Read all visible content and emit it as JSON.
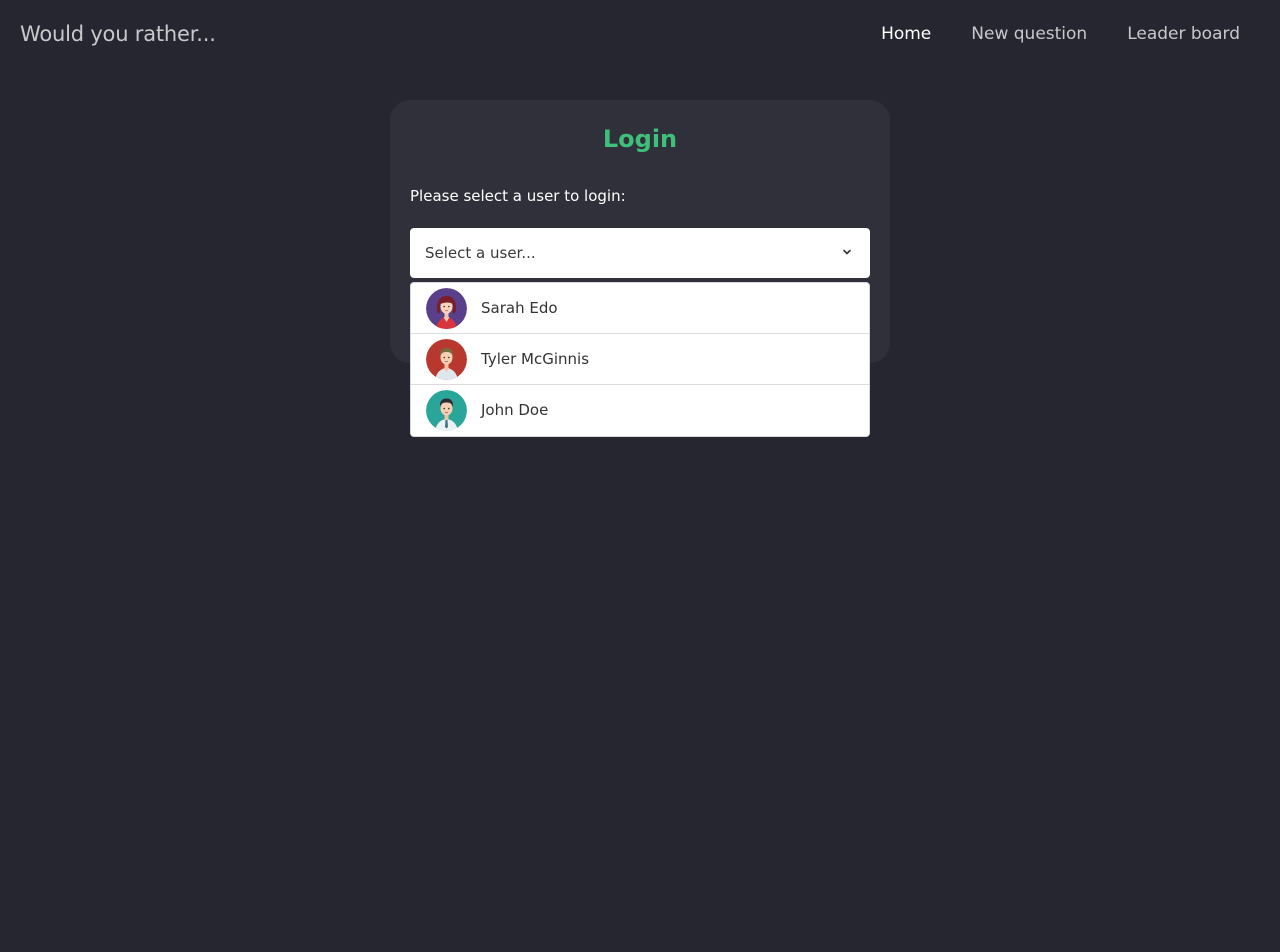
{
  "nav": {
    "brand": "Would you rather...",
    "links": [
      {
        "label": "Home",
        "active": true
      },
      {
        "label": "New question",
        "active": false
      },
      {
        "label": "Leader board",
        "active": false
      }
    ]
  },
  "login": {
    "title": "Login",
    "prompt": "Please select a user to login:",
    "select_placeholder": "Select a user...",
    "options": [
      {
        "name": "Sarah Edo",
        "avatar_bg": "#5a3f8a",
        "avatar_icon": "woman-avatar-icon"
      },
      {
        "name": "Tyler McGinnis",
        "avatar_bg": "#b8382f",
        "avatar_icon": "man-avatar-icon"
      },
      {
        "name": "John Doe",
        "avatar_bg": "#2aa59a",
        "avatar_icon": "man-avatar-icon"
      }
    ]
  },
  "colors": {
    "background": "#262630",
    "card": "#30303a",
    "accent": "#3ec07a"
  }
}
